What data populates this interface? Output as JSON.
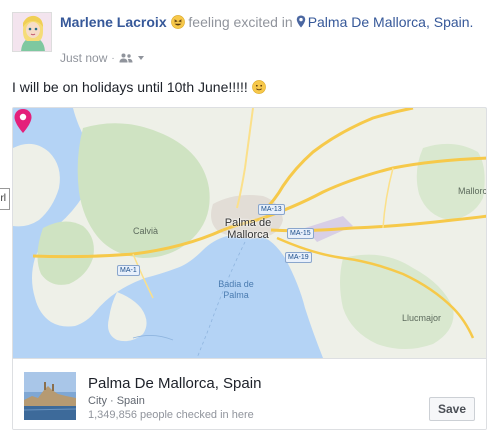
{
  "post": {
    "author": "Marlene Lacroix",
    "activity": "feeling excited in",
    "location": "Palma De Mallorca, Spain.",
    "timestamp": "Just now",
    "separator": "·",
    "audience_icon": "friends-icon",
    "message": "I will be on holidays until 10th June!!!!!",
    "message_emoji": "slightly-smiling-face-icon",
    "feeling_emoji": "excited-face-icon"
  },
  "map": {
    "labels": {
      "city": "Palma de Mallorca",
      "city_line1": "Palma de",
      "city_line2": "Mallorca",
      "calvia": "Calvià",
      "bay_line1": "Badia de",
      "bay_line2": "Palma",
      "llucmajor": "Llucmajor",
      "mallorca": "Mallorca",
      "side_tab": "rl"
    },
    "roads": {
      "ma13": "MA-13",
      "ma15": "MA-15",
      "ma19": "MA-19",
      "ma1": "MA-1"
    },
    "colors": {
      "water": "#b4d3f5",
      "land": "#eef0e8",
      "green": "#cfe3c2",
      "road": "#f6c94a",
      "pin": "#e4207a"
    }
  },
  "place": {
    "name": "Palma De Mallorca, Spain",
    "type": "City · Spain",
    "checkins": "1,349,856 people checked in here",
    "save_label": "Save"
  }
}
